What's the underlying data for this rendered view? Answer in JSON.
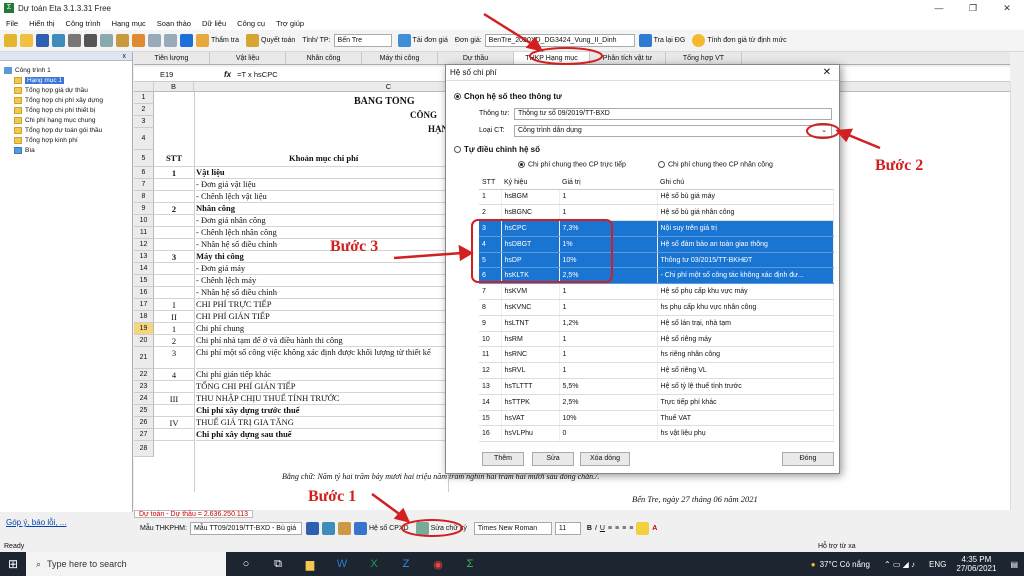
{
  "window": {
    "title": "Dự toán Eta 3.1.3.31 Free",
    "controls": [
      "—",
      "❐",
      "✕"
    ]
  },
  "menu": [
    "File",
    "Hiển thị",
    "Công trình",
    "Hạng mục",
    "Soạn thảo",
    "Dữ liệu",
    "Công cụ",
    "Trợ giúp"
  ],
  "toolbar": {
    "tham_tra": "Thẩm tra",
    "quyet_toan": "Quyết toán",
    "tinh_tp_label": "Tỉnh/ TP:",
    "tinh_tp_value": "Bến Tre",
    "tai_don_gia": "Tải đơn giá",
    "don_gia_label": "Đơn giá:",
    "don_gia_value": "BenTre_2020XD_DG3424_Vung_II_Dinh",
    "tra_lai_dg": "Tra lại ĐG",
    "tinh_don_gia": "Tính đơn giá từ định mức"
  },
  "sidebar": {
    "header": "x",
    "root": "Công trình 1",
    "items": [
      "Hạng mục 1",
      "Tổng hợp giá dự thầu",
      "Tổng hợp chi phí xây dựng",
      "Tổng hợp chi phí thiết bị",
      "Chi phí hạng mục chung",
      "Tổng hợp dự toán gói thầu",
      "Tổng hợp kinh phí",
      "Bìa"
    ],
    "footer_link": "Góp ý, báo lỗi, ..."
  },
  "tabs": [
    "Tiên lượng",
    "Vật liệu",
    "Nhân công",
    "Máy thi công",
    "Dự thầu",
    "THKP Hạng mục",
    "Phân tích vật tư",
    "Tổng hợp VT"
  ],
  "formula_bar": {
    "cell": "E19",
    "fx": "fx",
    "formula": "=T x hsCPC"
  },
  "columns": {
    "b": "B",
    "c": "C"
  },
  "sheet": {
    "title_1": "BẢNG TỔNG",
    "title_2": "CÔNG",
    "title_3": "HẠN",
    "header_stt": "STT",
    "header_item": "Khoản mục chi phí",
    "rows": [
      {
        "n": "6",
        "stt": "1",
        "text": "Vật liệu",
        "bold": true
      },
      {
        "n": "7",
        "stt": "",
        "text": "- Đơn giá vật liệu"
      },
      {
        "n": "8",
        "stt": "",
        "text": "- Chênh lệch vật liệu"
      },
      {
        "n": "9",
        "stt": "2",
        "text": "Nhân công",
        "bold": true
      },
      {
        "n": "10",
        "stt": "",
        "text": "- Đơn giá nhân công"
      },
      {
        "n": "11",
        "stt": "",
        "text": "- Chênh lệch nhân công"
      },
      {
        "n": "12",
        "stt": "",
        "text": "- Nhân hệ số điều chỉnh"
      },
      {
        "n": "13",
        "stt": "3",
        "text": "Máy thi công",
        "bold": true
      },
      {
        "n": "14",
        "stt": "",
        "text": "- Đơn giá máy"
      },
      {
        "n": "15",
        "stt": "",
        "text": "- Chênh lệch máy"
      },
      {
        "n": "16",
        "stt": "",
        "text": "- Nhân hệ số điều chỉnh"
      },
      {
        "n": "17",
        "stt": "I",
        "text": "CHI PHÍ TRỰC TIẾP"
      },
      {
        "n": "18",
        "stt": "II",
        "text": "CHI PHÍ GIÁN TIẾP"
      },
      {
        "n": "19",
        "stt": "1",
        "text": "Chi phí chung"
      },
      {
        "n": "20",
        "stt": "2",
        "text": "Chi phí nhà tạm để ở và điều hành thi công"
      },
      {
        "n": "21",
        "stt": "3",
        "text": "Chi phí một số công việc không xác định được khối lượng từ thiết kế"
      },
      {
        "n": "22",
        "stt": "4",
        "text": "Chi phí gián tiếp khác"
      },
      {
        "n": "23",
        "stt": "",
        "text": "TỔNG CHI PHÍ GIÁN TIẾP"
      },
      {
        "n": "24",
        "stt": "III",
        "text": "THU NHẬP CHỊU THUẾ TÍNH TRƯỚC"
      },
      {
        "n": "25",
        "stt": "",
        "text": "Chi phí xây dựng trước thuế",
        "bold": true
      },
      {
        "n": "26",
        "stt": "IV",
        "text": "THUẾ GIÁ TRỊ GIA TĂNG"
      },
      {
        "n": "27",
        "stt": "",
        "text": "Chi phí xây dựng sau thuế",
        "bold": true
      }
    ],
    "words_line": "Bằng chữ: Năm tỷ hai trăm bảy mươi hai triệu năm trăm nghìn hai trăm hai mươi sáu đồng chẵn./.",
    "date_line": "Bến Tre, ngày 27 tháng 06 năm 2021",
    "sheet_tab": "Dự toán - Dự thầu = 2.636.250.113"
  },
  "bottom_bar": {
    "mau_label": "Mẫu THKPHM:",
    "mau_value": "Mẫu TT09/2019/TT-BXD - Bù giá",
    "he_so_cpxd": "Hệ số CPXD",
    "sua_chu_ky": "Sửa chữ ký",
    "font_value": "Times New Roman",
    "font_size": "11"
  },
  "status": {
    "ready": "Ready",
    "ho_tro": "Hỗ trợ từ xa"
  },
  "dialog": {
    "title": "Hệ số chi phí",
    "close": "✕",
    "option1": "Chọn hệ số theo thông tư",
    "thong_tu_label": "Thông tư:",
    "thong_tu_value": "Thông tư số 09/2019/TT-BXD",
    "loai_ct_label": "Loại CT:",
    "loai_ct_value": "Công trình dân dụng",
    "option2": "Tự điều chỉnh hệ số",
    "sub1": "Chi phí chung theo CP trực tiếp",
    "sub2": "Chi phí chung theo CP nhân công",
    "table_headers": [
      "STT",
      "Ký hiệu",
      "Giá trị",
      "Ghi chú"
    ],
    "table_rows": [
      {
        "stt": "1",
        "code": "hsBGM",
        "val": "1",
        "note": "Hệ số bù giá máy",
        "hl": false
      },
      {
        "stt": "2",
        "code": "hsBGNC",
        "val": "1",
        "note": "Hệ số bù giá nhân công",
        "hl": false
      },
      {
        "stt": "3",
        "code": "hsCPC",
        "val": "7,3%",
        "note": "Nội suy trên giá trị",
        "hl": true
      },
      {
        "stt": "4",
        "code": "hsDBGT",
        "val": "1%",
        "note": "Hệ số đảm bảo an toàn giao thông",
        "hl": true
      },
      {
        "stt": "5",
        "code": "hsDP",
        "val": "10%",
        "note": "Thông tư 03/2015/TT-BKHĐT",
        "hl": true
      },
      {
        "stt": "6",
        "code": "hsKLTK",
        "val": "2,5%",
        "note": "- Chi phí một số công tác không xác định đư...",
        "hl": true
      },
      {
        "stt": "7",
        "code": "hsKVM",
        "val": "1",
        "note": "Hệ số phụ cấp khu vực máy",
        "hl": false
      },
      {
        "stt": "8",
        "code": "hsKVNC",
        "val": "1",
        "note": "hs phụ cấp khu vực nhân công",
        "hl": false
      },
      {
        "stt": "9",
        "code": "hsLTNT",
        "val": "1,2%",
        "note": "Hệ số lán trại, nhà tạm",
        "hl": false
      },
      {
        "stt": "10",
        "code": "hsRM",
        "val": "1",
        "note": "Hệ số riêng máy",
        "hl": false
      },
      {
        "stt": "11",
        "code": "hsRNC",
        "val": "1",
        "note": "hs riêng nhân công",
        "hl": false
      },
      {
        "stt": "12",
        "code": "hsRVL",
        "val": "1",
        "note": "Hệ số riêng VL",
        "hl": false
      },
      {
        "stt": "13",
        "code": "hsTLTTT",
        "val": "5,5%",
        "note": "Hệ số tỷ lệ thuế tính trước",
        "hl": false
      },
      {
        "stt": "14",
        "code": "hsTTPK",
        "val": "2,5%",
        "note": "Trực tiếp phí khác",
        "hl": false
      },
      {
        "stt": "15",
        "code": "hsVAT",
        "val": "10%",
        "note": "Thuế VAT",
        "hl": false
      },
      {
        "stt": "16",
        "code": "hsVLPhu",
        "val": "0",
        "note": "hs vật liệu phụ",
        "hl": false
      }
    ],
    "btn_them": "Thêm",
    "btn_sua": "Sửa",
    "btn_xoa": "Xóa dòng",
    "btn_dong": "Đóng"
  },
  "annotations": {
    "buoc1": "Bước 1",
    "buoc2": "Bước 2",
    "buoc3": "Bước 3"
  },
  "taskbar": {
    "search_placeholder": "Type here to search",
    "weather": "37°C Có nắng",
    "lang": "ENG",
    "time": "4:35 PM",
    "date": "27/06/2021"
  },
  "colors": {
    "annotation": "#d21f1f",
    "highlight": "#1a74d2",
    "taskbar": "#1c2530"
  }
}
